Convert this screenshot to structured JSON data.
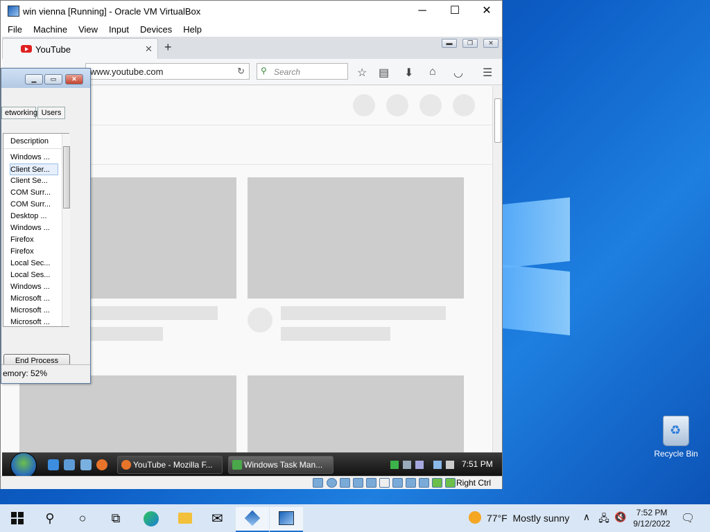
{
  "desktop": {
    "recycle_bin": "Recycle Bin"
  },
  "vbox": {
    "title": "win vienna [Running] - Oracle VM VirtualBox",
    "menu": [
      "File",
      "Machine",
      "View",
      "Input",
      "Devices",
      "Help"
    ],
    "host_key": "Right Ctrl"
  },
  "firefox": {
    "tab_title": "YouTube",
    "url": "www.youtube.com",
    "search_placeholder": "Search"
  },
  "taskmgr": {
    "tabs": [
      "etworking",
      "Users"
    ],
    "column": "Description",
    "rows": [
      "Windows ...",
      "Client Ser...",
      "Client Se...",
      "COM Surr...",
      "COM Surr...",
      "Desktop ...",
      "Windows ...",
      "Firefox",
      "Firefox",
      "Local Sec...",
      "Local Ses...",
      "Windows ...",
      "Microsoft ...",
      "Microsoft ...",
      "Microsoft ..."
    ],
    "selected_index": 1,
    "end_process": "End Process",
    "status": "emory: 52%"
  },
  "guest_taskbar": {
    "tasks": [
      "YouTube - Mozilla F...",
      "Windows Task Man..."
    ],
    "clock": "7:51 PM"
  },
  "host_taskbar": {
    "weather_temp": "77°F",
    "weather_text": "Mostly sunny",
    "time": "7:52 PM",
    "date": "9/12/2022"
  }
}
